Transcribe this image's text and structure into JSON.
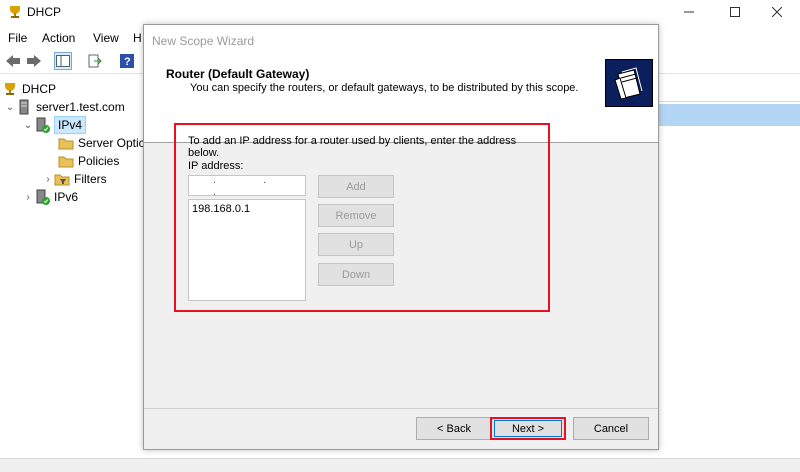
{
  "window": {
    "title": "DHCP"
  },
  "menu": [
    "File",
    "Action",
    "View",
    "H"
  ],
  "tree": {
    "root": "DHCP",
    "server": "server1.test.com",
    "ipv4": "IPv4",
    "server_options": "Server Optic",
    "policies": "Policies",
    "filters": "Filters",
    "ipv6": "IPv6"
  },
  "wizard": {
    "title": "New Scope Wizard",
    "heading": "Router (Default Gateway)",
    "subheading": "You can specify the routers, or default gateways, to be distributed by this scope.",
    "instruction": "To add an IP address for a router used by clients, enter the address below.",
    "ip_label": "IP address:",
    "ip_value": ". . .",
    "routers": [
      "198.168.0.1"
    ],
    "buttons": {
      "add": "Add",
      "remove": "Remove",
      "up": "Up",
      "down": "Down"
    },
    "footer": {
      "back": "< Back",
      "next": "Next >",
      "cancel": "Cancel"
    }
  },
  "colors": {
    "highlight": "#e81123",
    "selection": "#cce8ff",
    "right_selection": "#b4d6f5"
  },
  "icons": [
    "dhcp-app-icon",
    "minimize-icon",
    "maximize-icon",
    "close-icon",
    "back-arrow-icon",
    "forward-arrow-icon",
    "console-tree-icon",
    "export-icon",
    "help-icon",
    "server-icon",
    "folder-icon",
    "filter-icon",
    "wizard-graphic-icon"
  ]
}
